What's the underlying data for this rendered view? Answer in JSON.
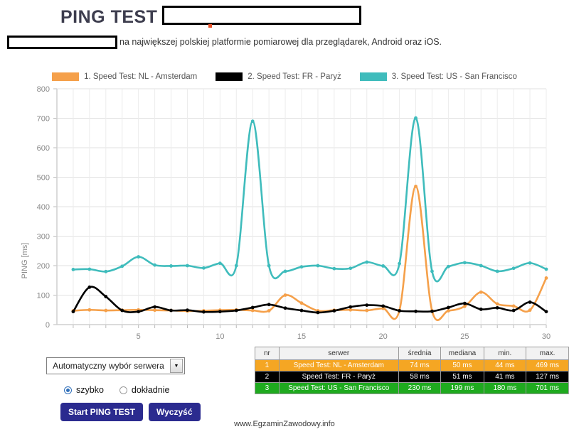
{
  "header": {
    "title_main": "PING TEST",
    "title_dash": "-",
    "subtitle_text": "na największej polskiej platformie pomiarowej dla przeglądarek, Android oraz iOS."
  },
  "chart": {
    "legend": [
      {
        "label": "1. Speed Test: NL - Amsterdam",
        "color": "#F5A04A"
      },
      {
        "label": "2. Speed Test: FR - Paryż",
        "color": "#000000"
      },
      {
        "label": "3. Speed Test: US - San Francisco",
        "color": "#3FBCBC"
      }
    ]
  },
  "chart_data": {
    "type": "line",
    "title": "",
    "xlabel": "",
    "ylabel": "PING [ms]",
    "xlim": [
      0,
      30
    ],
    "ylim": [
      0,
      800
    ],
    "grid": true,
    "legend_position": "top-center",
    "xticks": [
      5,
      10,
      15,
      20,
      25,
      30
    ],
    "yticks": [
      0,
      100,
      200,
      300,
      400,
      500,
      600,
      700,
      800
    ],
    "x": [
      1,
      2,
      3,
      4,
      5,
      6,
      7,
      8,
      9,
      10,
      11,
      12,
      13,
      14,
      15,
      16,
      17,
      18,
      19,
      20,
      21,
      22,
      23,
      24,
      25,
      26,
      27,
      28,
      29,
      30
    ],
    "series": [
      {
        "name": "1. Speed Test: NL - Amsterdam",
        "color": "#F5A04A",
        "values": [
          47,
          50,
          48,
          49,
          50,
          49,
          48,
          46,
          47,
          49,
          50,
          48,
          47,
          100,
          73,
          47,
          49,
          50,
          48,
          55,
          48,
          469,
          47,
          47,
          62,
          110,
          70,
          63,
          49,
          158
        ]
      },
      {
        "name": "2. Speed Test: FR - Paryż",
        "color": "#000000",
        "values": [
          44,
          127,
          95,
          48,
          44,
          60,
          48,
          49,
          43,
          44,
          48,
          58,
          68,
          56,
          48,
          41,
          47,
          60,
          66,
          63,
          47,
          45,
          45,
          58,
          72,
          52,
          57,
          48,
          76,
          44
        ]
      },
      {
        "name": "3. Speed Test: US - San Francisco",
        "color": "#3FBCBC",
        "values": [
          187,
          188,
          180,
          198,
          230,
          202,
          199,
          200,
          192,
          208,
          200,
          690,
          200,
          181,
          196,
          200,
          190,
          191,
          212,
          199,
          207,
          701,
          181,
          197,
          210,
          200,
          181,
          191,
          209,
          188
        ]
      }
    ]
  },
  "controls": {
    "server_select_value": "Automatyczny wybór serwera",
    "dropdown_arrow_glyph": "▼",
    "radios": [
      {
        "label": "szybko",
        "checked": true
      },
      {
        "label": "dokładnie",
        "checked": false
      }
    ],
    "buttons": [
      {
        "label": "Start PING TEST"
      },
      {
        "label": "Wyczyść"
      }
    ]
  },
  "results_table": {
    "headers": [
      "nr",
      "serwer",
      "średnia",
      "mediana",
      "min.",
      "max."
    ],
    "rows": [
      {
        "nr": "1",
        "serwer": "Speed Test: NL - Amsterdam",
        "srednia": "74 ms",
        "mediana": "50 ms",
        "min": "44 ms",
        "max": "469 ms"
      },
      {
        "nr": "2",
        "serwer": "Speed Test: FR - Paryż",
        "srednia": "58 ms",
        "mediana": "51 ms",
        "min": "41 ms",
        "max": "127 ms"
      },
      {
        "nr": "3",
        "serwer": "Speed Test: US - San Francisco",
        "srednia": "230 ms",
        "mediana": "199 ms",
        "min": "180 ms",
        "max": "701 ms"
      }
    ]
  },
  "watermark": "www.EgzaminZawodowy.info"
}
